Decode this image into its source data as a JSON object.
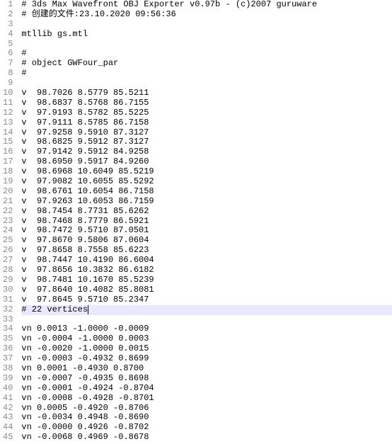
{
  "highlight_line_index": 31,
  "caret_line_index": 31,
  "lines": [
    "# 3ds Max Wavefront OBJ Exporter v0.97b - (c)2007 guruware",
    "# 创建的文件:23.10.2020 09:56:36",
    "",
    "mtllib gs.mtl",
    "",
    "#",
    "# object GWFour_par",
    "#",
    "",
    "v  98.7026 8.5779 85.5211",
    "v  98.6837 8.5768 86.7155",
    "v  97.9193 8.5782 85.5225",
    "v  97.9111 8.5785 86.7158",
    "v  97.9258 9.5910 87.3127",
    "v  98.6825 9.5912 87.3127",
    "v  97.9142 9.5912 84.9258",
    "v  98.6950 9.5917 84.9260",
    "v  98.6968 10.6049 85.5219",
    "v  97.9082 10.6055 85.5292",
    "v  98.6761 10.6054 86.7158",
    "v  97.9263 10.6053 86.7159",
    "v  98.7454 8.7731 85.6262",
    "v  98.7468 8.7779 86.5921",
    "v  98.7472 9.5710 87.0501",
    "v  97.8670 9.5806 87.0604",
    "v  97.8658 8.7558 85.6223",
    "v  98.7447 10.4190 86.6004",
    "v  97.8656 10.3832 86.6182",
    "v  98.7481 10.1670 85.5239",
    "v  97.8640 10.4082 85.8081",
    "v  97.8645 9.5710 85.2347",
    "# 22 vertices",
    "",
    "vn 0.0013 -1.0000 -0.0009",
    "vn -0.0004 -1.0000 0.0003",
    "vn -0.0020 -1.0000 0.0015",
    "vn -0.0003 -0.4932 0.8699",
    "vn 0.0001 -0.4930 0.8700",
    "vn -0.0007 -0.4935 0.8698",
    "vn -0.0001 -0.4924 -0.8704",
    "vn -0.0008 -0.4928 -0.8701",
    "vn 0.0005 -0.4920 -0.8706",
    "vn -0.0034 0.4948 -0.8690",
    "vn -0.0000 0.4926 -0.8702",
    "vn -0.0068 0.4969 -0.8678"
  ]
}
